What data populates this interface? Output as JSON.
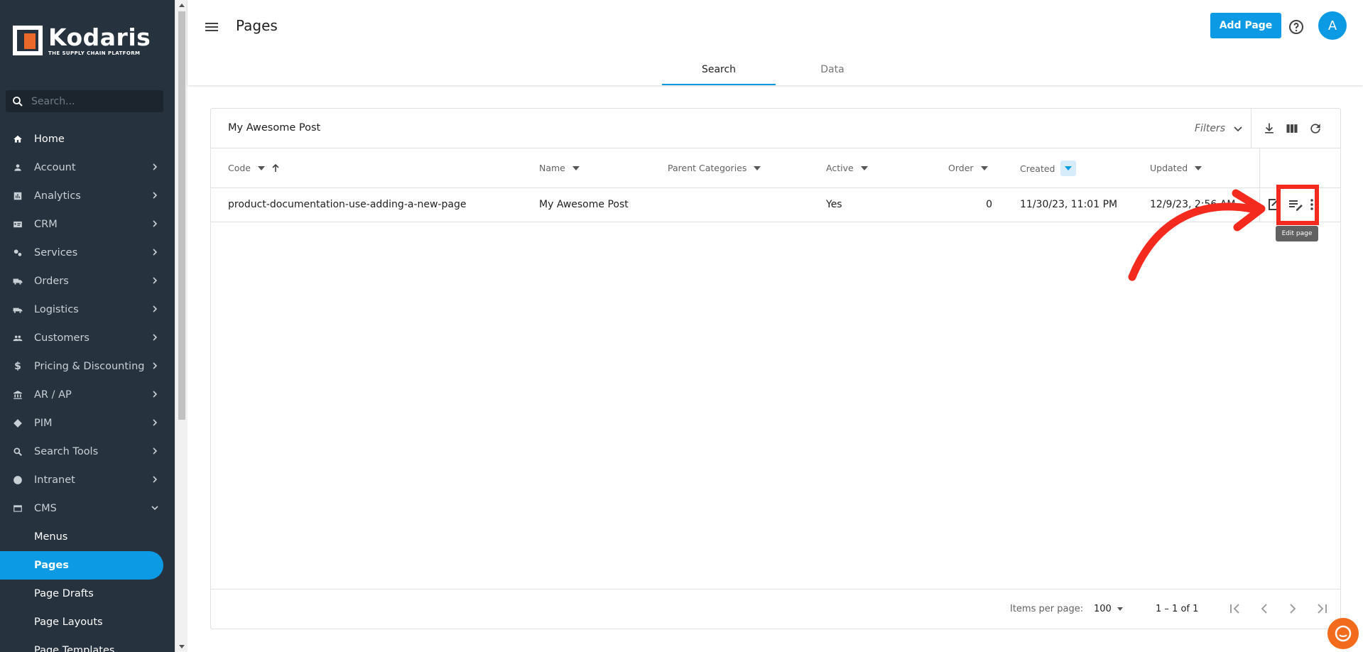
{
  "sidebar": {
    "brand": "Kodaris",
    "tagline": "THE SUPPLY CHAIN PLATFORM",
    "search_placeholder": "Search...",
    "items": [
      {
        "label": "Home",
        "icon": "home-icon"
      },
      {
        "label": "Account",
        "icon": "person-icon"
      },
      {
        "label": "Analytics",
        "icon": "analytics-icon"
      },
      {
        "label": "CRM",
        "icon": "crm-icon"
      },
      {
        "label": "Services",
        "icon": "gears-icon"
      },
      {
        "label": "Orders",
        "icon": "truck-icon"
      },
      {
        "label": "Logistics",
        "icon": "shipping-icon"
      },
      {
        "label": "Customers",
        "icon": "people-icon"
      },
      {
        "label": "Pricing & Discounting",
        "icon": "dollar-icon"
      },
      {
        "label": "AR / AP",
        "icon": "bank-icon"
      },
      {
        "label": "PIM",
        "icon": "tag-icon"
      },
      {
        "label": "Search Tools",
        "icon": "search-icon"
      },
      {
        "label": "Intranet",
        "icon": "globe-icon"
      },
      {
        "label": "CMS",
        "icon": "web-icon"
      }
    ],
    "cms_sub": [
      "Menus",
      "Pages",
      "Page Drafts",
      "Page Layouts",
      "Page Templates"
    ]
  },
  "header": {
    "title": "Pages",
    "add_button": "Add Page",
    "avatar_letter": "A",
    "tabs": [
      "Search",
      "Data"
    ]
  },
  "table": {
    "search_value": "My Awesome Post",
    "filters_label": "Filters",
    "columns": [
      "Code",
      "Name",
      "Parent Categories",
      "Active",
      "Order",
      "Created",
      "Updated"
    ],
    "rows": [
      {
        "code": "product-documentation-use-adding-a-new-page",
        "name": "My Awesome Post",
        "parent_categories": "",
        "active": "Yes",
        "order": "0",
        "created": "11/30/23, 11:01 PM",
        "updated": "12/9/23, 2:56 AM"
      }
    ]
  },
  "paginator": {
    "items_per_page_label": "Items per page:",
    "items_per_page": "100",
    "range": "1 – 1 of 1"
  },
  "tooltip": "Edit page",
  "colors": {
    "sidebar_bg": "#26323e",
    "accent": "#0d9ae5",
    "brand_orange": "#e8692a",
    "annotation_red": "#f42a1f"
  }
}
